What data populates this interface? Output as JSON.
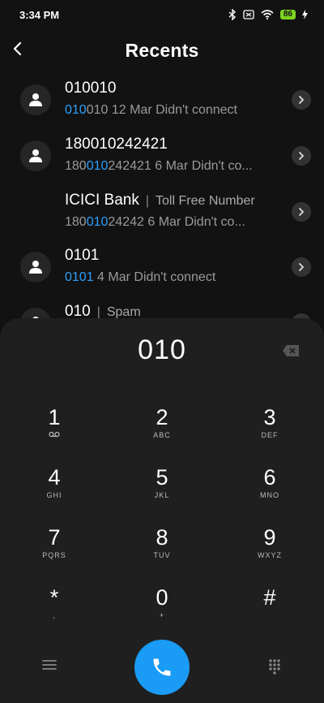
{
  "status_bar": {
    "time": "3:34 PM",
    "battery": "86"
  },
  "header": {
    "title": "Recents"
  },
  "recents": [
    {
      "name": "010010",
      "detail_match": "010",
      "detail_rest": "010 12 Mar Didn't connect",
      "has_avatar": true
    },
    {
      "name": "180010242421",
      "detail_pre": "180",
      "detail_match": "010",
      "detail_rest": "242421 6 Mar Didn't co...",
      "has_avatar": true
    },
    {
      "name": "ICICI Bank",
      "tag_sep": "|",
      "tag": "Toll Free Number",
      "detail_pre": "180",
      "detail_match": "010",
      "detail_rest": "24242 6 Mar Didn't co...",
      "has_avatar": false
    },
    {
      "name": "0101",
      "detail_match": "0101",
      "detail_rest": " 4 Mar Didn't connect",
      "has_avatar": true
    },
    {
      "name": "010",
      "tag_sep": "|",
      "tag": "Spam",
      "has_avatar": true
    }
  ],
  "dialer": {
    "number": "010",
    "keys": [
      {
        "digit": "1",
        "letters": ""
      },
      {
        "digit": "2",
        "letters": "ABC"
      },
      {
        "digit": "3",
        "letters": "DEF"
      },
      {
        "digit": "4",
        "letters": "GHI"
      },
      {
        "digit": "5",
        "letters": "JKL"
      },
      {
        "digit": "6",
        "letters": "MNO"
      },
      {
        "digit": "7",
        "letters": "PQRS"
      },
      {
        "digit": "8",
        "letters": "TUV"
      },
      {
        "digit": "9",
        "letters": "WXYZ"
      },
      {
        "digit": "*",
        "letters": ","
      },
      {
        "digit": "0",
        "letters": "+"
      },
      {
        "digit": "#",
        "letters": ""
      }
    ]
  },
  "colors": {
    "accent": "#1a9bf5",
    "highlight": "#2aa0ff",
    "battery": "#7ed321"
  },
  "icons": [
    "back-arrow-icon",
    "bluetooth-icon",
    "wifi-icon",
    "voicemail-icon",
    "backspace-icon",
    "menu-icon",
    "phone-icon",
    "dialpad-icon"
  ]
}
